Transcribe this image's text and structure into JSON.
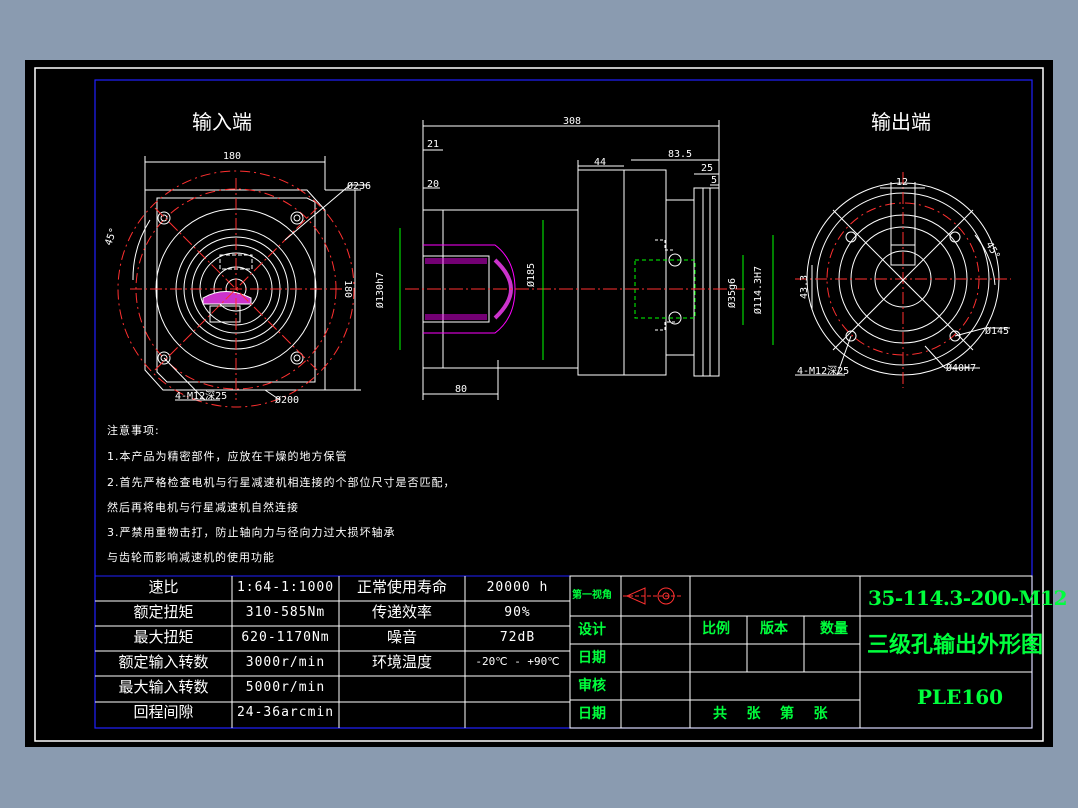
{
  "views": {
    "input_title": "输入端",
    "output_title": "输出端"
  },
  "dimensions": {
    "d180_top": "180",
    "d180_side": "180",
    "d236": "Ø236",
    "d45_left": "45°",
    "d4m12_left": "4-M12深25",
    "d200": "Ø200",
    "d308": "308",
    "d21": "21",
    "d20": "20",
    "d44": "44",
    "d83_5": "83.5",
    "d25": "25",
    "d5": "5",
    "d80": "80",
    "d130": "Ø130h7",
    "d185": "Ø185",
    "d35": "Ø35g6",
    "d114": "Ø114.3H7",
    "d12": "12",
    "d43_3": "43.3",
    "d45_right": "45°",
    "d145": "Ø145",
    "d40h7": "Ø40H7",
    "d4m12_right": "4-M12深25"
  },
  "notes": [
    "注意事项:",
    "1.本产品为精密部件，应放在干燥的地方保管",
    "2.首先严格检查电机与行星减速机相连接的个部位尺寸是否匹配，",
    "然后再将电机与行星减速机自然连接",
    "3.严禁用重物击打，防止轴向力与径向力过大损坏轴承",
    "与齿轮而影响减速机的使用功能"
  ],
  "specs": [
    {
      "label": "速比",
      "value": "1:64-1:1000",
      "label2": "正常使用寿命",
      "value2": "20000 h"
    },
    {
      "label": "额定扭矩",
      "value": "310-585Nm",
      "label2": "传递效率",
      "value2": "90%"
    },
    {
      "label": "最大扭矩",
      "value": "620-1170Nm",
      "label2": "噪音",
      "value2": "72dB"
    },
    {
      "label": "额定输入转数",
      "value": "3000r/min",
      "label2": "环境温度",
      "value2": "-20℃ - +90℃"
    },
    {
      "label": "最大输入转数",
      "value": "5000r/min",
      "label2": "",
      "value2": ""
    },
    {
      "label": "回程间隙",
      "value": "24-36arcmin",
      "label2": "",
      "value2": ""
    }
  ],
  "title_block": {
    "angle": "第一视角",
    "design": "设计",
    "date1": "日期",
    "review": "审核",
    "date2": "日期",
    "scale": "比例",
    "version": "版本",
    "qty": "数量",
    "sheets": "共    张    第    张",
    "part_no": "35-114.3-200-M12",
    "drawing_name": "三级孔输出外形图",
    "model": "PLE160"
  },
  "colors": {
    "frame": "#ffffff",
    "inner_frame": "#2020ff",
    "title_text": "#00ff3c",
    "outline": "#ffffff",
    "centerline": "#ff3030",
    "dimension": "#ffffff",
    "hidden": "#00ff00",
    "hatch": "#ff00ff"
  }
}
